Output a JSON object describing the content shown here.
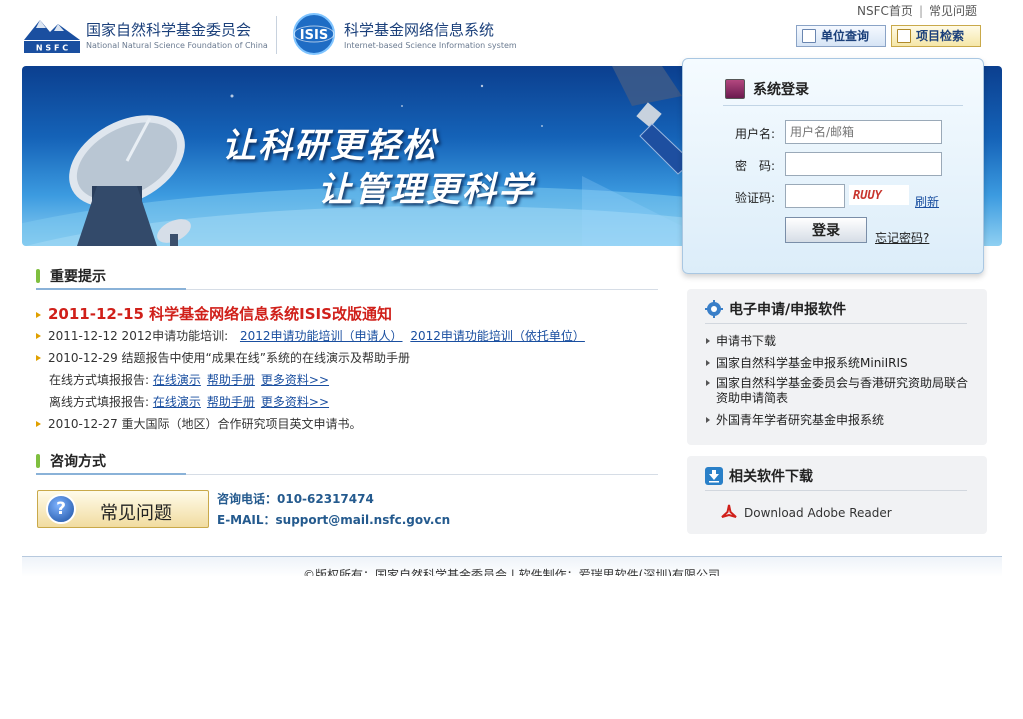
{
  "header": {
    "nsfc_logo_letters": "N S F C",
    "nsfc_name_cn": "国家自然科学基金委员会",
    "nsfc_name_en": "National Natural Science Foundation of China",
    "isis_logo_text": "ISIS",
    "isis_name_cn": "科学基金网络信息系统",
    "isis_name_en": "Internet-based Science Information system",
    "top_links": [
      "NSFC首页",
      "常见问题"
    ],
    "btn_unit_query": "单位查询",
    "btn_project_search": "项目检索"
  },
  "banner": {
    "slogan_1": "让科研更轻松",
    "slogan_2": "让管理更科学"
  },
  "login": {
    "title": "系统登录",
    "username_label": "用户名:",
    "username_placeholder": "用户名/邮箱",
    "password_label": "密　码:",
    "captcha_label": "验证码:",
    "captcha_code": "RUUY",
    "refresh_label": "刷新",
    "submit_label": "登录",
    "forgot_label": "忘记密码?"
  },
  "notices": {
    "title": "重要提示",
    "headline": "2011-12-15 科学基金网络信息系统ISIS改版通知",
    "item_2_prefix": "2011-12-12 2012申请功能培训:",
    "item_2_links": [
      "2012申请功能培训（申请人）",
      "2012申请功能培训（依托单位）"
    ],
    "item_3": "2010-12-29 结题报告中使用“成果在线”系统的在线演示及帮助手册",
    "online_label": "在线方式填报报告:",
    "offline_label": "离线方式填报报告:",
    "sub_links": [
      "在线演示",
      "帮助手册",
      "更多资料>>"
    ],
    "item_4": "2010-12-27 重大国际（地区）合作研究项目英文申请书。"
  },
  "contact": {
    "title": "咨询方式",
    "faq_label": "常见问题",
    "faq_icon": "?",
    "phone_line": "咨询电话：010-62317474",
    "email_line": "E-MAIL：support@mail.nsfc.gov.cn"
  },
  "sidebar": {
    "e_apply_title": "电子申请/申报软件",
    "e_apply_items": [
      "申请书下载",
      "国家自然科学基金申报系统MiniIRIS",
      "国家自然科学基金委员会与香港研究资助局联合资助申请简表",
      "外国青年学者研究基金申报系统"
    ],
    "download_title": "相关软件下载",
    "adobe_label": "Download Adobe Reader"
  },
  "footer": {
    "text": "©版权所有：国家自然科学基金委员会 | 软件制作：爱瑞思软件(深圳)有限公司"
  },
  "colors": {
    "headline_red": "#d0201a",
    "link_blue": "#1a4fa0",
    "section_bar_green": "#7fbf3f",
    "banner_blue": "#1563b8"
  }
}
